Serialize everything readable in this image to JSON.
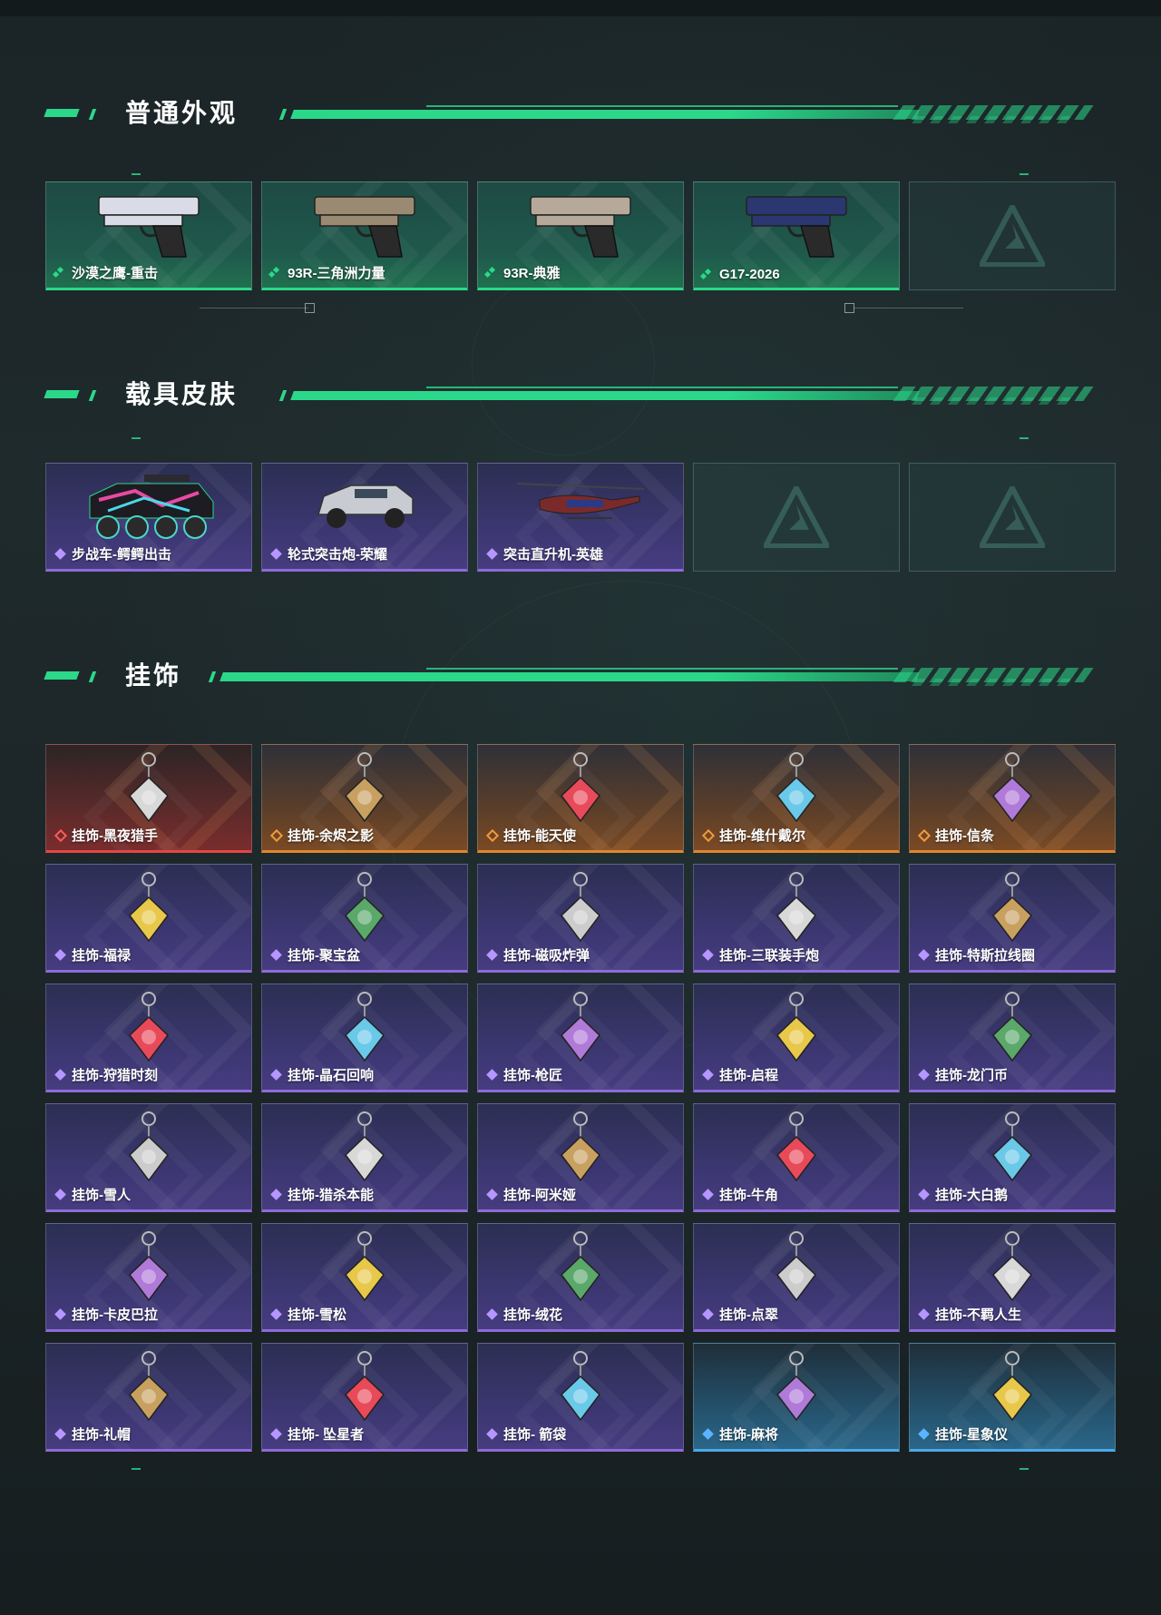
{
  "sections": {
    "weapons": {
      "title": "普通外观",
      "items": [
        {
          "name": "沙漠之鹰-重击",
          "rarity": "green"
        },
        {
          "name": "93R-三角洲力量",
          "rarity": "green"
        },
        {
          "name": "93R-典雅",
          "rarity": "green"
        },
        {
          "name": "G17-2026",
          "rarity": "green"
        }
      ]
    },
    "vehicles": {
      "title": "载具皮肤",
      "items": [
        {
          "name": "步战车-鳄鳄出击",
          "rarity": "purple"
        },
        {
          "name": "轮式突击炮-荣耀",
          "rarity": "purple"
        },
        {
          "name": "突击直升机-英雄",
          "rarity": "purple"
        }
      ]
    },
    "charms": {
      "title": "挂饰",
      "rows": [
        [
          {
            "name": "挂饰-黑夜猎手",
            "rarity": "red"
          },
          {
            "name": "挂饰-余烬之影",
            "rarity": "orange"
          },
          {
            "name": "挂饰-能天使",
            "rarity": "orange"
          },
          {
            "name": "挂饰-维什戴尔",
            "rarity": "orange"
          },
          {
            "name": "挂饰-信条",
            "rarity": "orange"
          }
        ],
        [
          {
            "name": "挂饰-福禄",
            "rarity": "purple"
          },
          {
            "name": "挂饰-聚宝盆",
            "rarity": "purple"
          },
          {
            "name": "挂饰-磁吸炸弹",
            "rarity": "purple"
          },
          {
            "name": "挂饰-三联装手炮",
            "rarity": "purple"
          },
          {
            "name": "挂饰-特斯拉线圈",
            "rarity": "purple"
          }
        ],
        [
          {
            "name": "挂饰-狩猎时刻",
            "rarity": "purple"
          },
          {
            "name": "挂饰-晶石回响",
            "rarity": "purple"
          },
          {
            "name": "挂饰-枪匠",
            "rarity": "purple"
          },
          {
            "name": "挂饰-启程",
            "rarity": "purple"
          },
          {
            "name": "挂饰-龙门币",
            "rarity": "purple"
          }
        ],
        [
          {
            "name": "挂饰-雪人",
            "rarity": "purple"
          },
          {
            "name": "挂饰-猎杀本能",
            "rarity": "purple"
          },
          {
            "name": "挂饰-阿米娅",
            "rarity": "purple"
          },
          {
            "name": "挂饰-牛角",
            "rarity": "purple"
          },
          {
            "name": "挂饰-大白鹅",
            "rarity": "purple"
          }
        ],
        [
          {
            "name": "挂饰-卡皮巴拉",
            "rarity": "purple"
          },
          {
            "name": "挂饰-雪松",
            "rarity": "purple"
          },
          {
            "name": "挂饰-绒花",
            "rarity": "purple"
          },
          {
            "name": "挂饰-点翠",
            "rarity": "purple"
          },
          {
            "name": "挂饰-不羁人生",
            "rarity": "purple"
          }
        ],
        [
          {
            "name": "挂饰-礼帽",
            "rarity": "purple"
          },
          {
            "name": "挂饰- 坠星者",
            "rarity": "purple"
          },
          {
            "name": "挂饰- 箭袋",
            "rarity": "purple"
          },
          {
            "name": "挂饰-麻将",
            "rarity": "blue"
          },
          {
            "name": "挂饰-星象仪",
            "rarity": "blue"
          }
        ]
      ]
    }
  },
  "colors": {
    "accent": "#2bd88a",
    "green_rarity": "#2bd88a",
    "purple_rarity": "#8e6bd8",
    "orange_rarity": "#e0862e",
    "red_rarity": "#e24646",
    "blue_rarity": "#4ea8e8"
  },
  "icons": {
    "rarity_marker": "rarity-diamond-icon",
    "empty_slot_logo": "delta-logo-icon"
  }
}
